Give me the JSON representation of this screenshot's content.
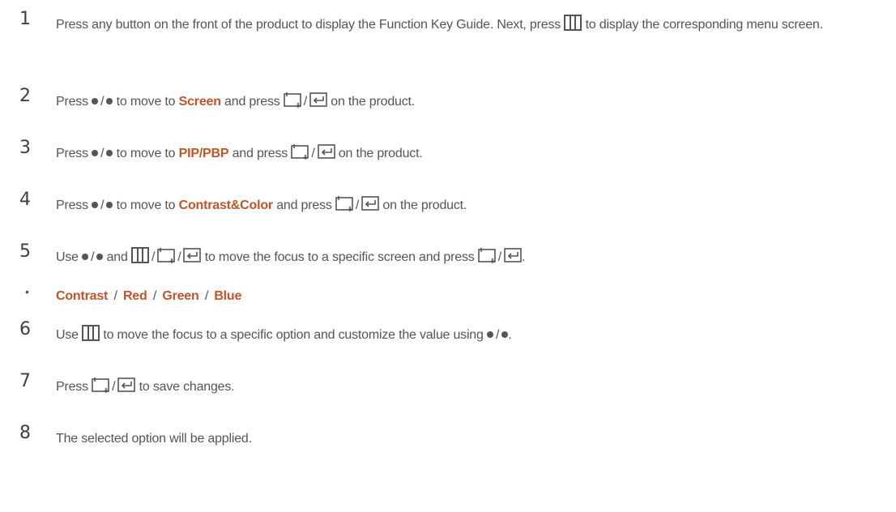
{
  "steps": [
    {
      "num": "1",
      "a": "Press any button on the front of the product to display the Function Key Guide. Next, press",
      "b": "to display the corresponding menu screen."
    },
    {
      "num": "2",
      "a": "Press",
      "b": "to move to",
      "target": "Screen",
      "c": "and press",
      "d": "on the product."
    },
    {
      "num": "3",
      "a": "Press",
      "b": "to move to",
      "target": "PIP/PBP",
      "c": "and press",
      "d": "on the product."
    },
    {
      "num": "4",
      "a": "Press",
      "b": "to move to",
      "target": "Contrast&Color",
      "c": "and press",
      "d": "on the product."
    },
    {
      "num": "5",
      "a": "Use",
      "b": "and",
      "c": "to move the focus to a specific screen and press",
      "d": "."
    },
    {
      "num": "6",
      "a": "Use",
      "b": "to move the focus to a specific option and customize the value using",
      "c": "."
    },
    {
      "num": "7",
      "a": "Press",
      "b": "to save changes."
    },
    {
      "num": "8",
      "a": "The selected option will be applied."
    }
  ],
  "options": {
    "bullet": "•",
    "items": [
      "Contrast",
      "Red",
      "Green",
      "Blue"
    ],
    "sep": "/"
  },
  "icons": {
    "up_down": "dot-icon",
    "menu": "menu-grid-icon",
    "enter": "enter-icon",
    "return": "return-icon"
  },
  "colors": {
    "highlight": "#c0552a",
    "text": "#555555",
    "number": "#404040"
  }
}
